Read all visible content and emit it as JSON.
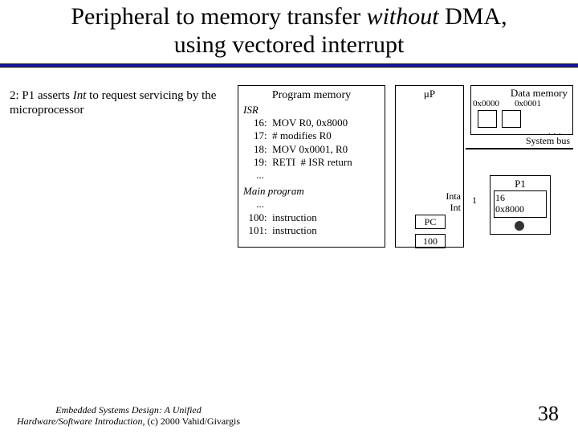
{
  "title_line1": "Peripheral to memory transfer ",
  "title_without": "without",
  "title_line1b": " DMA,",
  "title_line2": "using vectored interrupt",
  "step": {
    "prefix": "2: P1 asserts ",
    "int_word": "Int",
    "suffix": " to request servicing by the microprocessor"
  },
  "progmem": {
    "title": "Program memory",
    "isr_label": "ISR",
    "lines": [
      "    16:  MOV R0, 0x8000",
      "    17:  # modifies R0",
      "    18:  MOV 0x0001, R0",
      "    19:  RETI  # ISR return",
      "     ..."
    ],
    "main_label": "Main program",
    "main_lines": [
      "     ...",
      "  100:  instruction",
      "  101:  instruction"
    ]
  },
  "up": {
    "label": "μP",
    "inta": "Inta",
    "int": "Int",
    "pc": "PC",
    "hundred": "100"
  },
  "datamem": {
    "title": "Data memory",
    "addr0": "0x0000",
    "addr1": "0x0001",
    "dots": "..."
  },
  "sysbus": "System bus",
  "p1": {
    "title": "P1",
    "sixteen": "16",
    "addr": "0x8000"
  },
  "one": "1",
  "footer": {
    "credit1": "Embedded Systems Design: A Unified",
    "credit2a": "Hardware/Software Introduction,",
    "credit2b": " (c) 2000 Vahid/Givargis",
    "page": "38"
  }
}
